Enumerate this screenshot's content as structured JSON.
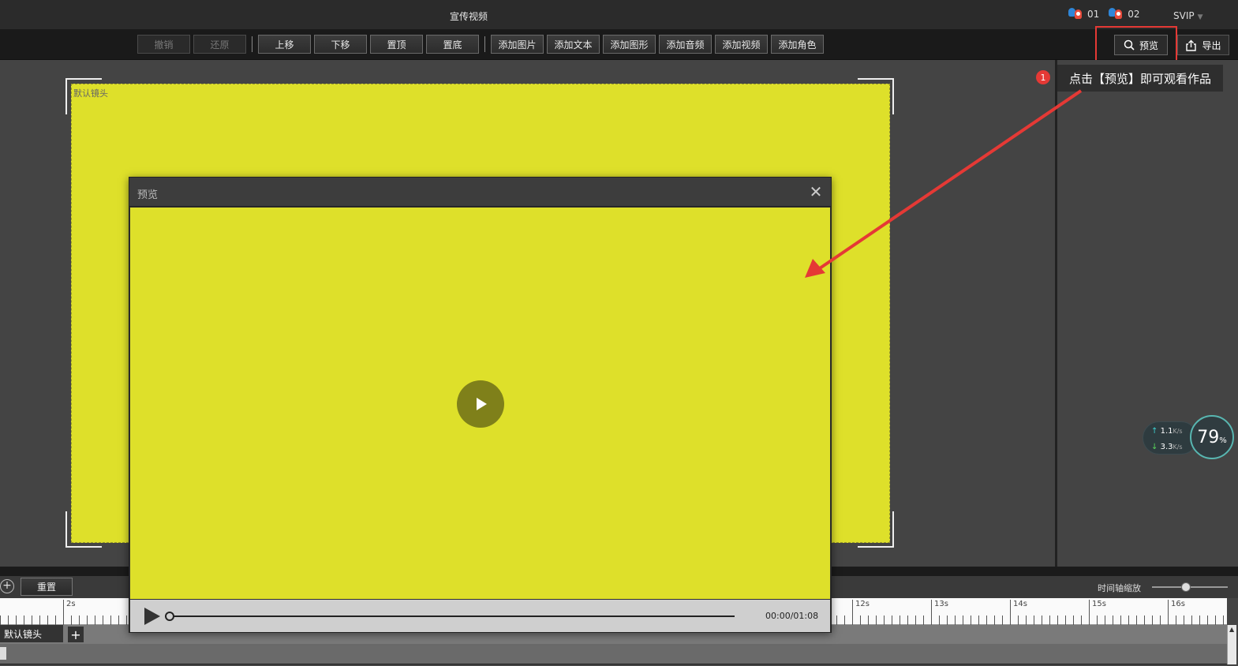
{
  "window": {
    "title": "宣传视频"
  },
  "users": [
    {
      "label": "01",
      "icon": "qq-user-icon"
    },
    {
      "label": "02",
      "icon": "qq-user-icon"
    }
  ],
  "membership": {
    "label": "SVIP"
  },
  "toolbar": {
    "undo": "撤销",
    "redo": "还原",
    "move_up": "上移",
    "move_down": "下移",
    "to_top": "置顶",
    "to_bottom": "置底",
    "add_image": "添加图片",
    "add_text": "添加文本",
    "add_shape": "添加图形",
    "add_audio": "添加音频",
    "add_video": "添加视频",
    "add_character": "添加角色",
    "preview": "预览",
    "export": "导出"
  },
  "scene": {
    "label": "默认镜头",
    "color": "#dee02a"
  },
  "tutorial": {
    "step": "1",
    "text": "点击【预览】即可观看作品"
  },
  "network": {
    "upload": "1.1",
    "upload_unit": "K/s",
    "download": "3.3",
    "download_unit": "K/s",
    "usage": "79",
    "usage_unit": "%"
  },
  "timeline": {
    "reset": "重置",
    "zoom_label": "时间轴缩放",
    "zoom_level": 0.45,
    "ticks": [
      "2s",
      "12s",
      "13s",
      "14s",
      "15s",
      "16s"
    ],
    "track_name": "默认镜头"
  },
  "preview_dialog": {
    "title": "预览",
    "time": "00:00/01:08",
    "progress": 0.0
  }
}
